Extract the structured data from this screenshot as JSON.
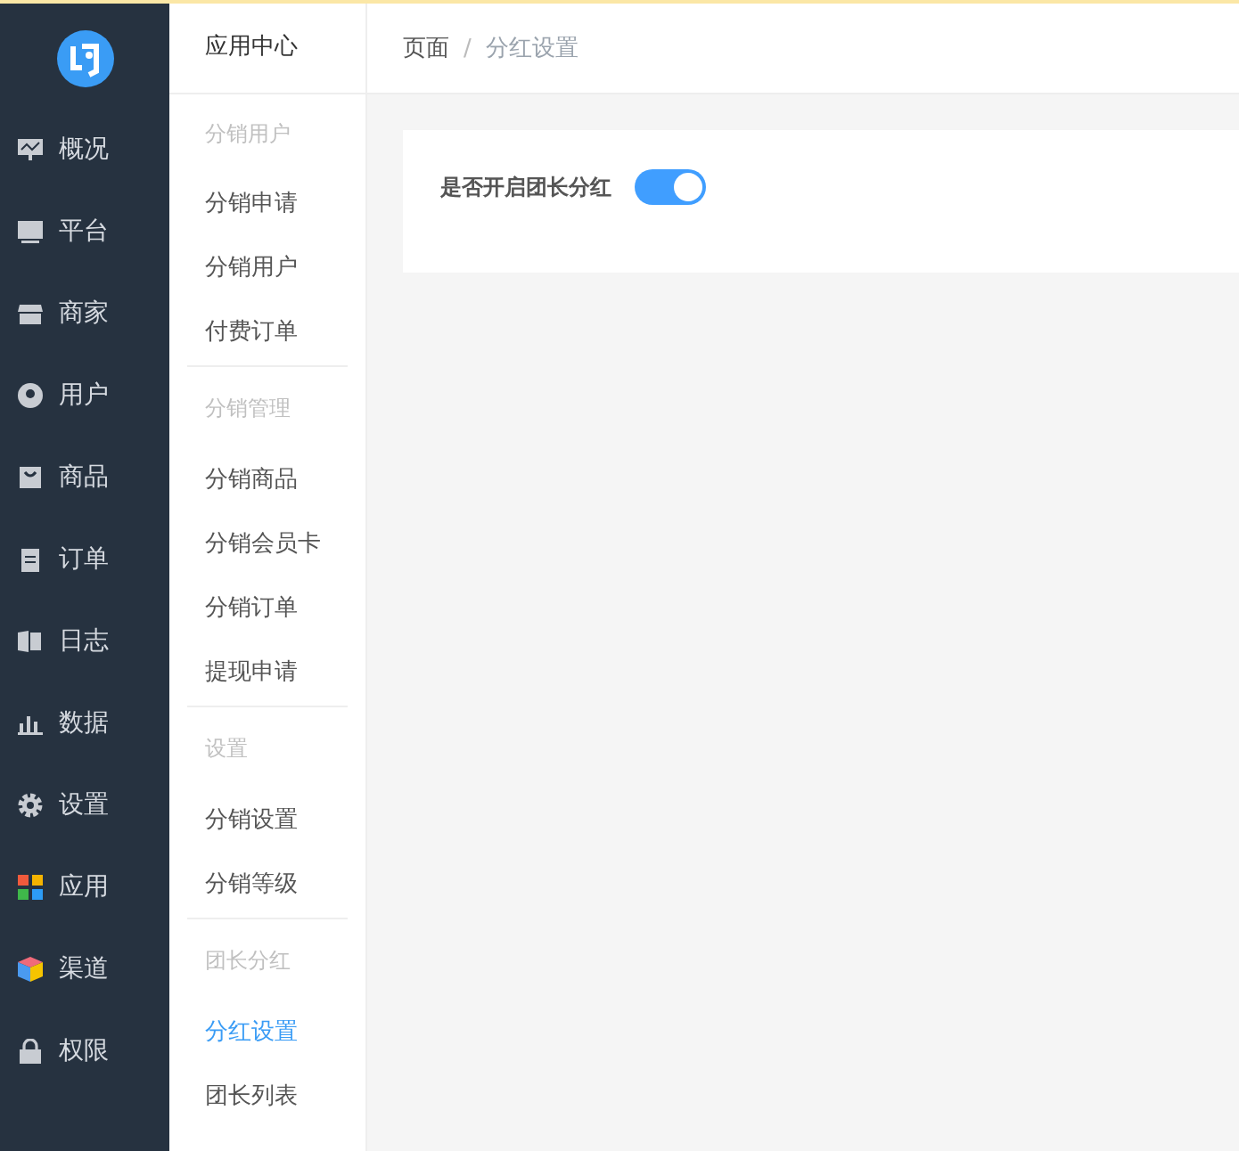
{
  "main_nav": {
    "items": [
      {
        "label": "概况",
        "selected": false
      },
      {
        "label": "平台",
        "selected": false
      },
      {
        "label": "商家",
        "selected": false
      },
      {
        "label": "用户",
        "selected": false
      },
      {
        "label": "商品",
        "selected": false
      },
      {
        "label": "订单",
        "selected": false
      },
      {
        "label": "日志",
        "selected": false
      },
      {
        "label": "数据",
        "selected": false
      },
      {
        "label": "设置",
        "selected": false
      },
      {
        "label": "应用",
        "selected": false
      },
      {
        "label": "渠道",
        "selected": false
      },
      {
        "label": "权限",
        "selected": false
      }
    ]
  },
  "sub_nav": {
    "title": "应用中心",
    "groups": [
      {
        "title": "分销用户",
        "items": [
          {
            "label": "分销申请",
            "selected": false
          },
          {
            "label": "分销用户",
            "selected": false
          },
          {
            "label": "付费订单",
            "selected": false
          }
        ]
      },
      {
        "title": "分销管理",
        "items": [
          {
            "label": "分销商品",
            "selected": false
          },
          {
            "label": "分销会员卡",
            "selected": false
          },
          {
            "label": "分销订单",
            "selected": false
          },
          {
            "label": "提现申请",
            "selected": false
          }
        ]
      },
      {
        "title": "设置",
        "items": [
          {
            "label": "分销设置",
            "selected": false
          },
          {
            "label": "分销等级",
            "selected": false
          }
        ]
      },
      {
        "title": "团长分红",
        "items": [
          {
            "label": "分红设置",
            "selected": true
          },
          {
            "label": "团长列表",
            "selected": false
          }
        ]
      }
    ]
  },
  "breadcrumb": {
    "separator": "/",
    "items": [
      "页面",
      "分红设置"
    ]
  },
  "settings": [
    {
      "label": "是否开启团长分红",
      "on": true
    }
  ]
}
